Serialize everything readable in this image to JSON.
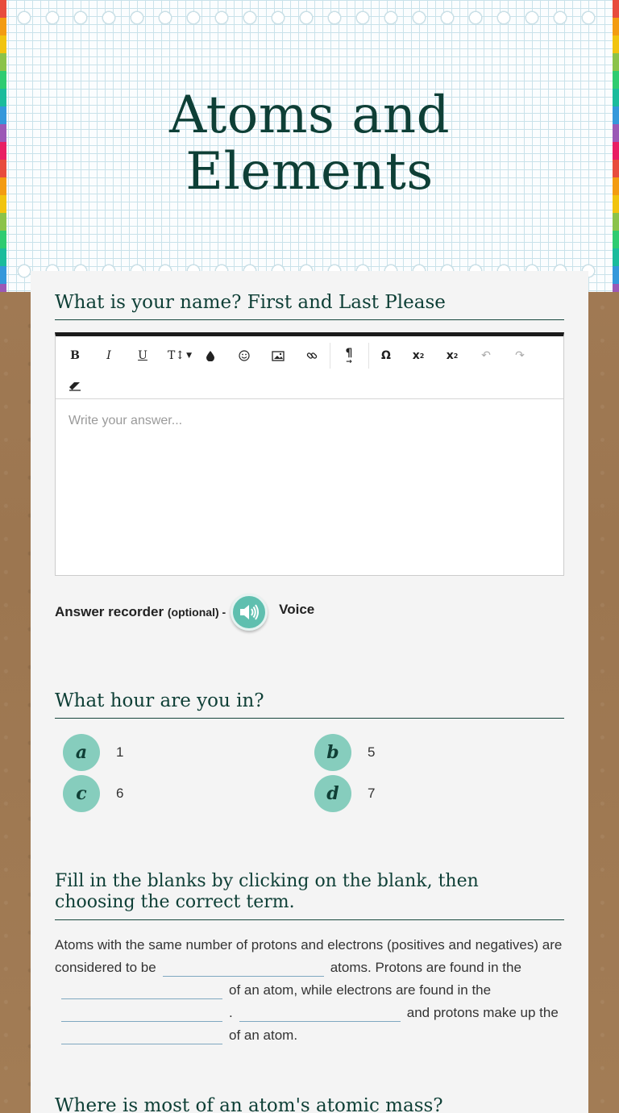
{
  "header": {
    "title_line1": "Atoms and",
    "title_line2": "Elements"
  },
  "q1": {
    "title": "What is your name? First and Last Please",
    "toolbar": [
      "B",
      "I",
      "U",
      "TI",
      "ink-drop",
      "emoji",
      "image",
      "link",
      "pilcrow",
      "Ω",
      "x₂",
      "x²",
      "undo",
      "redo",
      "eraser"
    ],
    "placeholder": "Write your answer...",
    "recorder_label": "Answer recorder",
    "recorder_optional": "(optional) -",
    "voice_label": "Voice"
  },
  "q2": {
    "title": "What hour are you in?",
    "options": [
      {
        "letter": "a",
        "text": "1"
      },
      {
        "letter": "b",
        "text": "5"
      },
      {
        "letter": "c",
        "text": "6"
      },
      {
        "letter": "d",
        "text": "7"
      }
    ]
  },
  "q3": {
    "title_line1": "Fill in the blanks by clicking on the blank, then",
    "title_line2": "choosing the correct term.",
    "p1": "Atoms with the same number of protons and electrons (positives and negatives) are considered to be",
    "p2": "atoms. Protons are found in the",
    "p3": "of an atom, while electrons are found in the",
    "p4": ".",
    "p5": "and protons make up the",
    "p6": "of an atom."
  },
  "q4": {
    "title": "Where is most of an atom's atomic mass?"
  },
  "colors": {
    "accent": "#0e3f36",
    "bubble": "#86cdbd",
    "voice": "#5fbfaf"
  }
}
